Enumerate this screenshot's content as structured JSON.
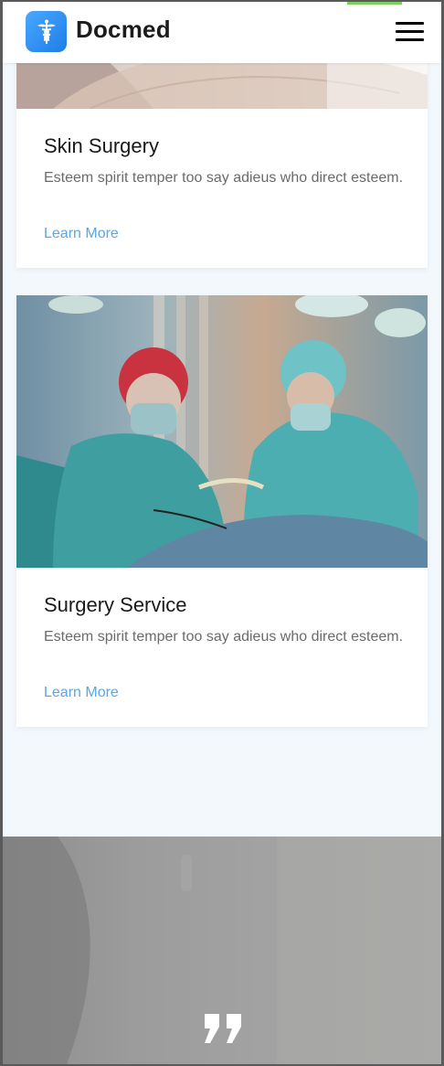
{
  "app": {
    "brand_name": "Docmed",
    "logo_icon": "caduceus-icon",
    "menu_icon": "hamburger-menu-icon",
    "accent_color": "#3a95f5",
    "link_color": "#5aa6e8"
  },
  "services": [
    {
      "title": "Skin Surgery",
      "description": "Esteem spirit temper too say adieus who direct esteem.",
      "link_label": "Learn More"
    },
    {
      "title": "Surgery Service",
      "description": "Esteem spirit temper too say adieus who direct esteem.",
      "link_label": "Learn More"
    }
  ],
  "testimonial": {
    "quote_icon": "quote-icon"
  }
}
